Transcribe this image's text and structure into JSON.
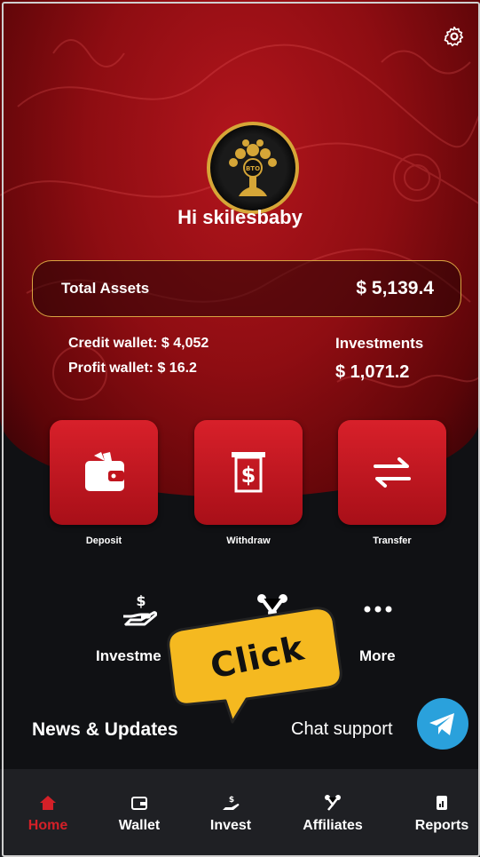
{
  "header": {
    "greeting": "Hi skilesbaby",
    "logo_text": "BTO"
  },
  "assets": {
    "label": "Total Assets",
    "value": "$ 5,139.4"
  },
  "wallets": {
    "credit": "Credit wallet: $ 4,052",
    "profit": "Profit wallet: $ 16.2",
    "investments_label": "Investments",
    "investments_value": "$ 1,071.2"
  },
  "actions": [
    {
      "label": "Deposit",
      "icon": "wallet-icon"
    },
    {
      "label": "Withdraw",
      "icon": "dollar-receipt-icon"
    },
    {
      "label": "Transfer",
      "icon": "transfer-arrows-icon"
    }
  ],
  "shortcuts": [
    {
      "label": "Investme",
      "icon": "hand-dollar-icon"
    },
    {
      "label": "",
      "icon": "affiliates-nodes-icon"
    },
    {
      "label": "More",
      "icon": "more-dots-icon"
    }
  ],
  "news": {
    "title": "News & Updates"
  },
  "chat": {
    "label": "Chat support",
    "icon": "telegram-icon"
  },
  "tooltip": {
    "text": "Click"
  },
  "nav": [
    {
      "label": "Home",
      "icon": "home-icon",
      "active": true
    },
    {
      "label": "Wallet",
      "icon": "wallet-icon"
    },
    {
      "label": "Invest",
      "icon": "hand-dollar-icon"
    },
    {
      "label": "Affiliates",
      "icon": "affiliates-icon"
    },
    {
      "label": "Reports",
      "icon": "reports-icon"
    }
  ],
  "colors": {
    "accent": "#d42028",
    "gold": "#d9a441",
    "telegram": "#2aa1dc",
    "tooltip": "#f5b920"
  }
}
